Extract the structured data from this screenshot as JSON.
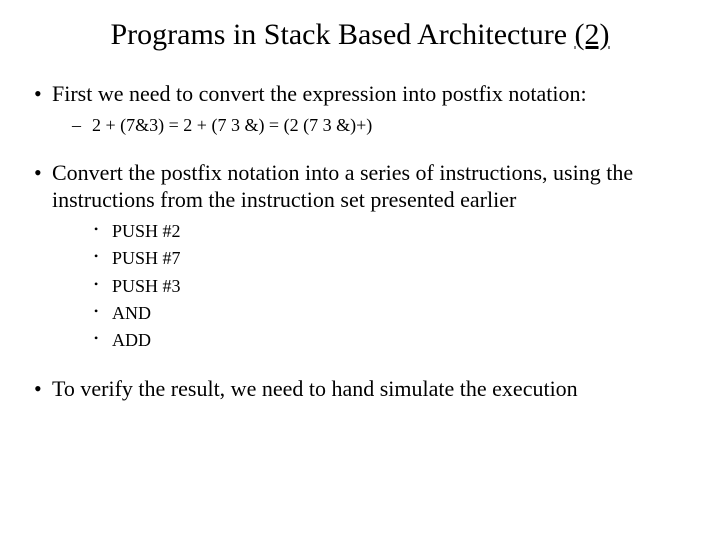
{
  "title_plain": "Programs in Stack Based Architecture ",
  "title_underlined": "(2)",
  "bullets": {
    "b1": "First we need to convert the expression into postfix notation:",
    "b1_sub": "2 + (7&3) = 2 + (7 3 &) = (2 (7 3 &)+)",
    "b2": "Convert the postfix notation into a series of instructions, using the instructions from the instruction set presented earlier",
    "b2_sub": [
      "PUSH #2",
      "PUSH #7",
      "PUSH #3",
      "AND",
      "ADD"
    ],
    "b3": "To verify the result, we need to hand simulate the execution"
  }
}
